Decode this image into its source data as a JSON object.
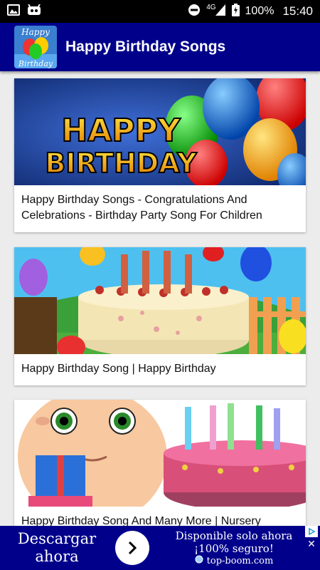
{
  "status_bar": {
    "network": "4G",
    "battery": "100%",
    "time": "15:40",
    "icons": [
      "image-icon",
      "android-icon",
      "do-not-disturb-icon",
      "signal-icon",
      "battery-icon"
    ]
  },
  "app_bar": {
    "title": "Happy Birthday Songs",
    "logo_text": "Happy Birthday",
    "color": "#00008b"
  },
  "videos": [
    {
      "title": "Happy Birthday Songs - Congratulations And Celebrations - Birthday Party Song For Children",
      "thumb_text": "HAPPY BIRTHDAY"
    },
    {
      "title": "Happy Birthday Song | Happy Birthday"
    },
    {
      "title": "Happy Birthday Song And Many More | Nursery"
    }
  ],
  "ad": {
    "cta_line1": "Descargar",
    "cta_line2": "ahora",
    "line1": "Disponible solo ahora",
    "line2": "¡100% seguro!",
    "domain": "top-boom.com",
    "icons": [
      "arrow-right-icon",
      "ad-choices-icon",
      "close-icon",
      "globe-icon"
    ]
  }
}
